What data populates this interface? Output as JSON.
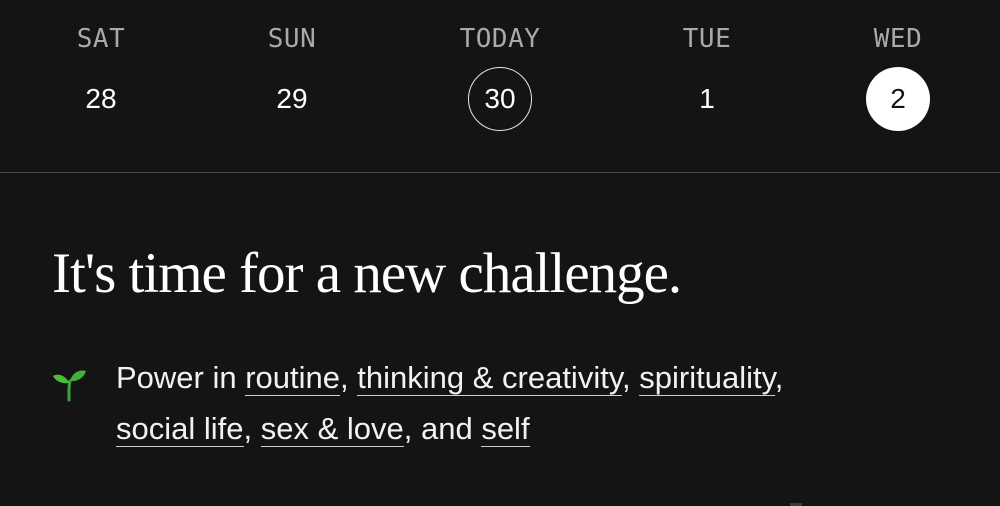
{
  "date_strip": {
    "days": [
      {
        "label": "SAT",
        "number": "28"
      },
      {
        "label": "SUN",
        "number": "29"
      },
      {
        "label": "TODAY",
        "number": "30"
      },
      {
        "label": "TUE",
        "number": "1"
      },
      {
        "label": "WED",
        "number": "2"
      }
    ]
  },
  "challenge": {
    "headline": "It's time for a new challenge.",
    "intro": "Power in ",
    "areas": [
      "routine",
      "thinking & creativity",
      "spirituality",
      "social life",
      "sex & love",
      "self"
    ],
    "separator": ", ",
    "conjunction": ", and ",
    "icon": "seedling-icon"
  },
  "colors": {
    "background": "#141414",
    "text": "#ffffff",
    "muted_label": "#a9a9a9",
    "divider": "#474747",
    "selected_circle": "#ffffff",
    "sprout": "#3aa63a"
  }
}
